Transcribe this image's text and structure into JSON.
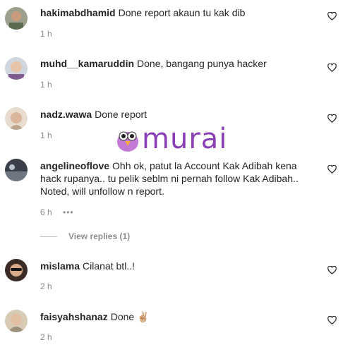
{
  "colors": {
    "username": "#262626",
    "meta": "#8e8e8e",
    "brand": "#8b3fb5"
  },
  "comments": [
    {
      "username": "hakimabdhamid",
      "text": "Done report akaun tu kak dib",
      "time": "1 h"
    },
    {
      "username": "muhd__kamaruddin",
      "text": "Done, bangang punya hacker",
      "time": "1 h"
    },
    {
      "username": "nadz.wawa",
      "text": "Done report",
      "time": "1 h"
    },
    {
      "username": "angelineoflove",
      "text_lines": [
        "Ohh ok, patut la Account Kak Adibah kena",
        "hack rupanya.. tu pelik seblm ni pernah follow Kak Adibah..",
        "Noted, will unfollow n report."
      ],
      "time": "6 h",
      "more": "•••"
    },
    {
      "username": "mislama",
      "text": "Cilanat btl..!",
      "time": "2 h"
    },
    {
      "username": "faisyahshanaz",
      "text": "Done ✌🏼",
      "time": "2 h"
    }
  ],
  "replies": {
    "label": "View replies (1)"
  },
  "watermark": {
    "text": "murai"
  },
  "icons": {
    "like": "heart-outline-icon",
    "more": "more-horizontal-icon"
  }
}
